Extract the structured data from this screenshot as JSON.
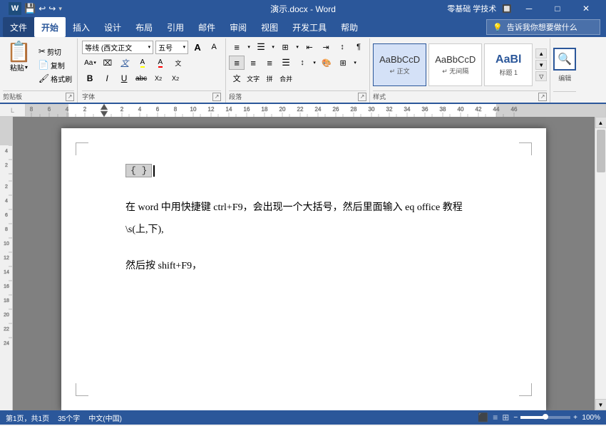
{
  "titlebar": {
    "filename": "演示.docx - Word",
    "right_label": "零基础 学技术",
    "minimize": "─",
    "restore": "□",
    "close": "✕"
  },
  "quickaccess": {
    "save": "💾",
    "undo": "↩",
    "redo": "↪",
    "more": "▾"
  },
  "menu": {
    "items": [
      "文件",
      "开始",
      "插入",
      "设计",
      "布局",
      "引用",
      "邮件",
      "审阅",
      "视图",
      "开发工具",
      "帮助"
    ],
    "active": "开始"
  },
  "ribbon": {
    "clipboard_label": "剪贴板",
    "font_label": "字体",
    "paragraph_label": "段落",
    "styles_label": "样式",
    "editing_label": "编辑",
    "font_name": "等线 (西文正▾",
    "font_size": "五号▾",
    "style_items": [
      "AaBbCcD",
      "AaBbCcD",
      "AaBl"
    ],
    "style_labels": [
      "↵ 正文",
      "↵ 无间隔",
      "标题 1"
    ],
    "search_placeholder": "告诉我你想要做什么",
    "search_icon": "🔍"
  },
  "document": {
    "field_code": "{ }",
    "cursor_visible": true,
    "line1": "在 word 中用快捷键 ctrl+F9，会出现一个大括号，然后里面输入 eq office 教程\\s(上,下),",
    "line2": "然后按 shift+F9，"
  },
  "statusbar": {
    "page": "第1页，共1页",
    "words": "35个字",
    "lang": "中文(中国)",
    "zoom": "100%",
    "view_buttons": [
      "■",
      "≡",
      "⊞"
    ]
  }
}
